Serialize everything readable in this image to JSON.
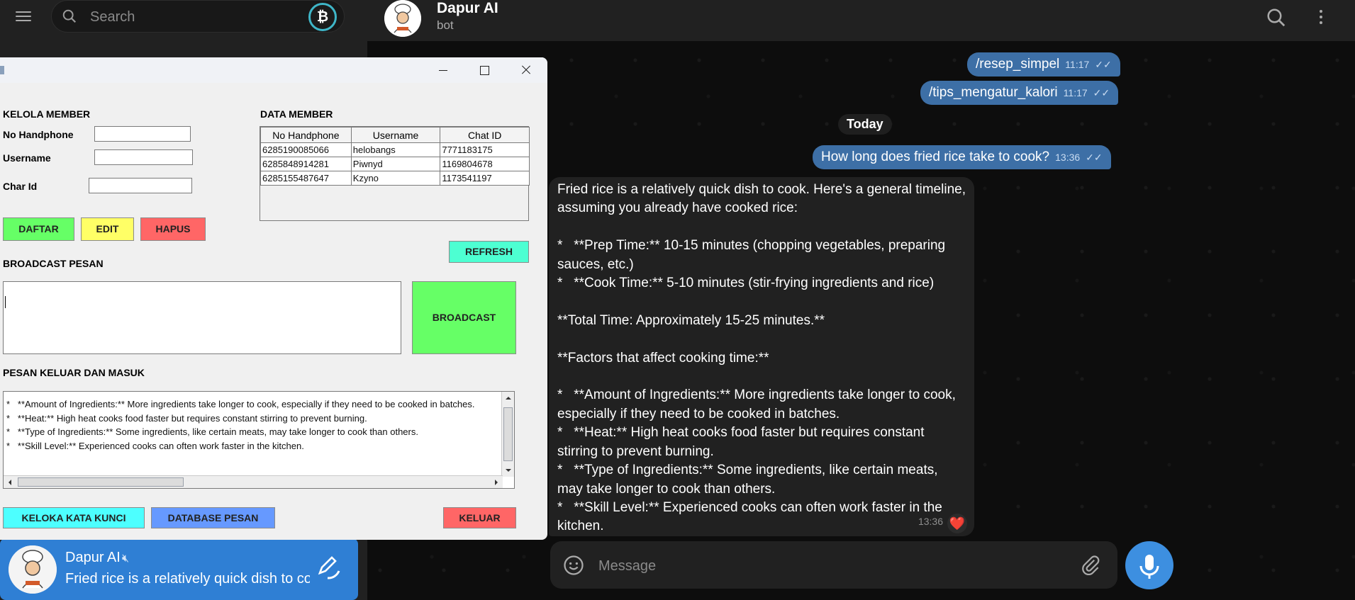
{
  "telegram": {
    "search": {
      "placeholder": "Search"
    },
    "chat_item": {
      "name": "Dapur AI",
      "preview": "Fried rice is a relatively quick dish to co"
    },
    "header": {
      "title": "Dapur AI",
      "status": "bot"
    },
    "messages": [
      {
        "text": "/resep_simpel",
        "time": "11:17"
      },
      {
        "text": "/tips_mengatur_kalori",
        "time": "11:17"
      },
      {
        "text": "How long does fried rice  take to cook?",
        "time": "13:36"
      }
    ],
    "day_label": "Today",
    "bot_reply": {
      "text": "Fried rice is a relatively quick dish to cook. Here's a general timeline, assuming you already have cooked rice:\n\n*   **Prep Time:** 10-15 minutes (chopping vegetables, preparing sauces, etc.)\n*   **Cook Time:** 5-10 minutes (stir-frying ingredients and rice)\n\n**Total Time: Approximately 15-25 minutes.**\n\n**Factors that affect cooking time:**\n\n*   **Amount of Ingredients:** More ingredients take longer to cook, especially if they need to be cooked in batches.\n*   **Heat:** High heat cooks food faster but requires constant stirring to prevent burning.\n*   **Type of Ingredients:** Some ingredients, like certain meats, may take longer to cook than others.\n*   **Skill Level:** Experienced cooks can often work faster in the kitchen.",
      "time": "13:36",
      "reaction": "❤️"
    },
    "compose": {
      "placeholder": "Message"
    },
    "colors": {
      "accent": "#3d8fe0",
      "outgoing_bubble": "#3d6fa6",
      "incoming_bubble": "#212121"
    }
  },
  "app": {
    "kelola_title": "KELOLA MEMBER",
    "labels": {
      "phone": "No Handphone",
      "username": "Username",
      "chat_id": "Char Id"
    },
    "buttons": {
      "daftar": "DAFTAR",
      "edit": "EDIT",
      "hapus": "HAPUS",
      "refresh": "REFRESH",
      "broadcast": "BROADCAST",
      "keloka": "KELOKA KATA KUNCI",
      "database": "DATABASE PESAN",
      "keluar": "KELUAR"
    },
    "data_member_title": "DATA  MEMBER",
    "table": {
      "headers": [
        "No Handphone",
        "Username",
        "Chat ID"
      ],
      "rows": [
        [
          "6285190085066",
          "helobangs",
          "7771183175"
        ],
        [
          "6285848914281",
          "Piwnyd",
          "1169804678"
        ],
        [
          "6285155487647",
          "Kzyno",
          "1173541197"
        ]
      ]
    },
    "broadcast_title": "BROADCAST PESAN",
    "log_title": "PESAN KELUAR DAN MASUK",
    "log_text": "*   **Amount of Ingredients:** More ingredients take longer to cook, especially if they need to be cooked in batches.\n*   **Heat:** High heat cooks food faster but requires constant stirring to prevent burning.\n*   **Type of Ingredients:** Some ingredients, like certain meats, may take longer to cook than others.\n*   **Skill Level:** Experienced cooks can often work faster in the kitchen.",
    "colors": {
      "daftar": "#66ff66",
      "edit": "#ffff66",
      "hapus": "#ff6666",
      "refresh": "#4dffd2",
      "broadcast": "#66ff66",
      "keloka": "#4dffff",
      "database": "#6699ff",
      "keluar": "#ff6666"
    }
  }
}
